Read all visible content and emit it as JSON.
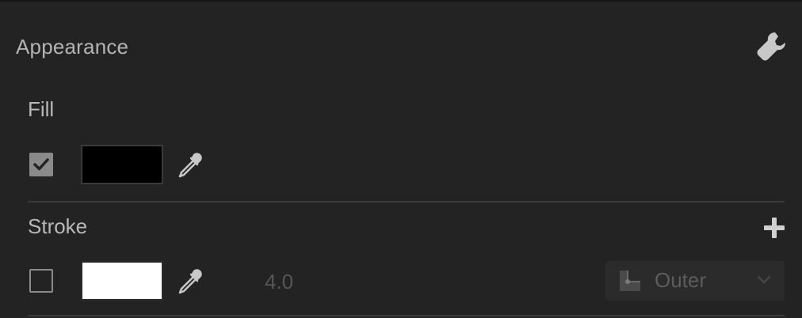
{
  "panel": {
    "title": "Appearance",
    "settings_icon": "wrench-icon"
  },
  "fill": {
    "label": "Fill",
    "enabled": true,
    "color": "#000000",
    "picker_icon": "eyedropper-icon"
  },
  "stroke": {
    "label": "Stroke",
    "enabled": false,
    "color": "#ffffff",
    "picker_icon": "eyedropper-icon",
    "add_icon": "plus-icon",
    "width": "4.0",
    "alignment": {
      "selected": "Outer",
      "icon": "stroke-outer-align-icon"
    }
  },
  "colors": {
    "background": "#232323",
    "text": "#b8b8b8",
    "disabled_text": "#555555"
  }
}
